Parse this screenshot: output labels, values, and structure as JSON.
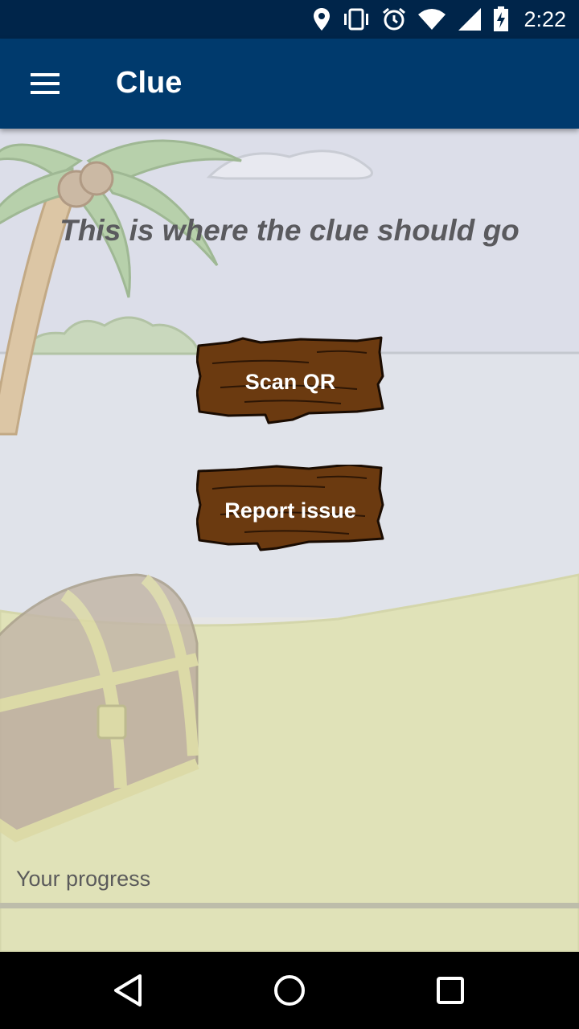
{
  "status_bar": {
    "time": "2:22",
    "icons": [
      "location-icon",
      "vibrate-icon",
      "alarm-icon",
      "wifi-icon",
      "signal-icon",
      "battery-charging-icon"
    ]
  },
  "app_bar": {
    "title": "Clue",
    "menu_icon": "hamburger-menu-icon"
  },
  "main": {
    "clue_text": "This is where the clue should go",
    "scan_button_label": "Scan QR",
    "report_button_label": "Report issue",
    "progress_label": "Your progress",
    "progress_value": 0
  },
  "nav_bar": {
    "icons": [
      "back-icon",
      "home-icon",
      "recents-icon"
    ]
  },
  "colors": {
    "status_bar": "#00254a",
    "app_bar": "#003a6d",
    "plank": "#6b3a10",
    "sky": "#dfe2ea",
    "sand": "#e0e2b8"
  }
}
